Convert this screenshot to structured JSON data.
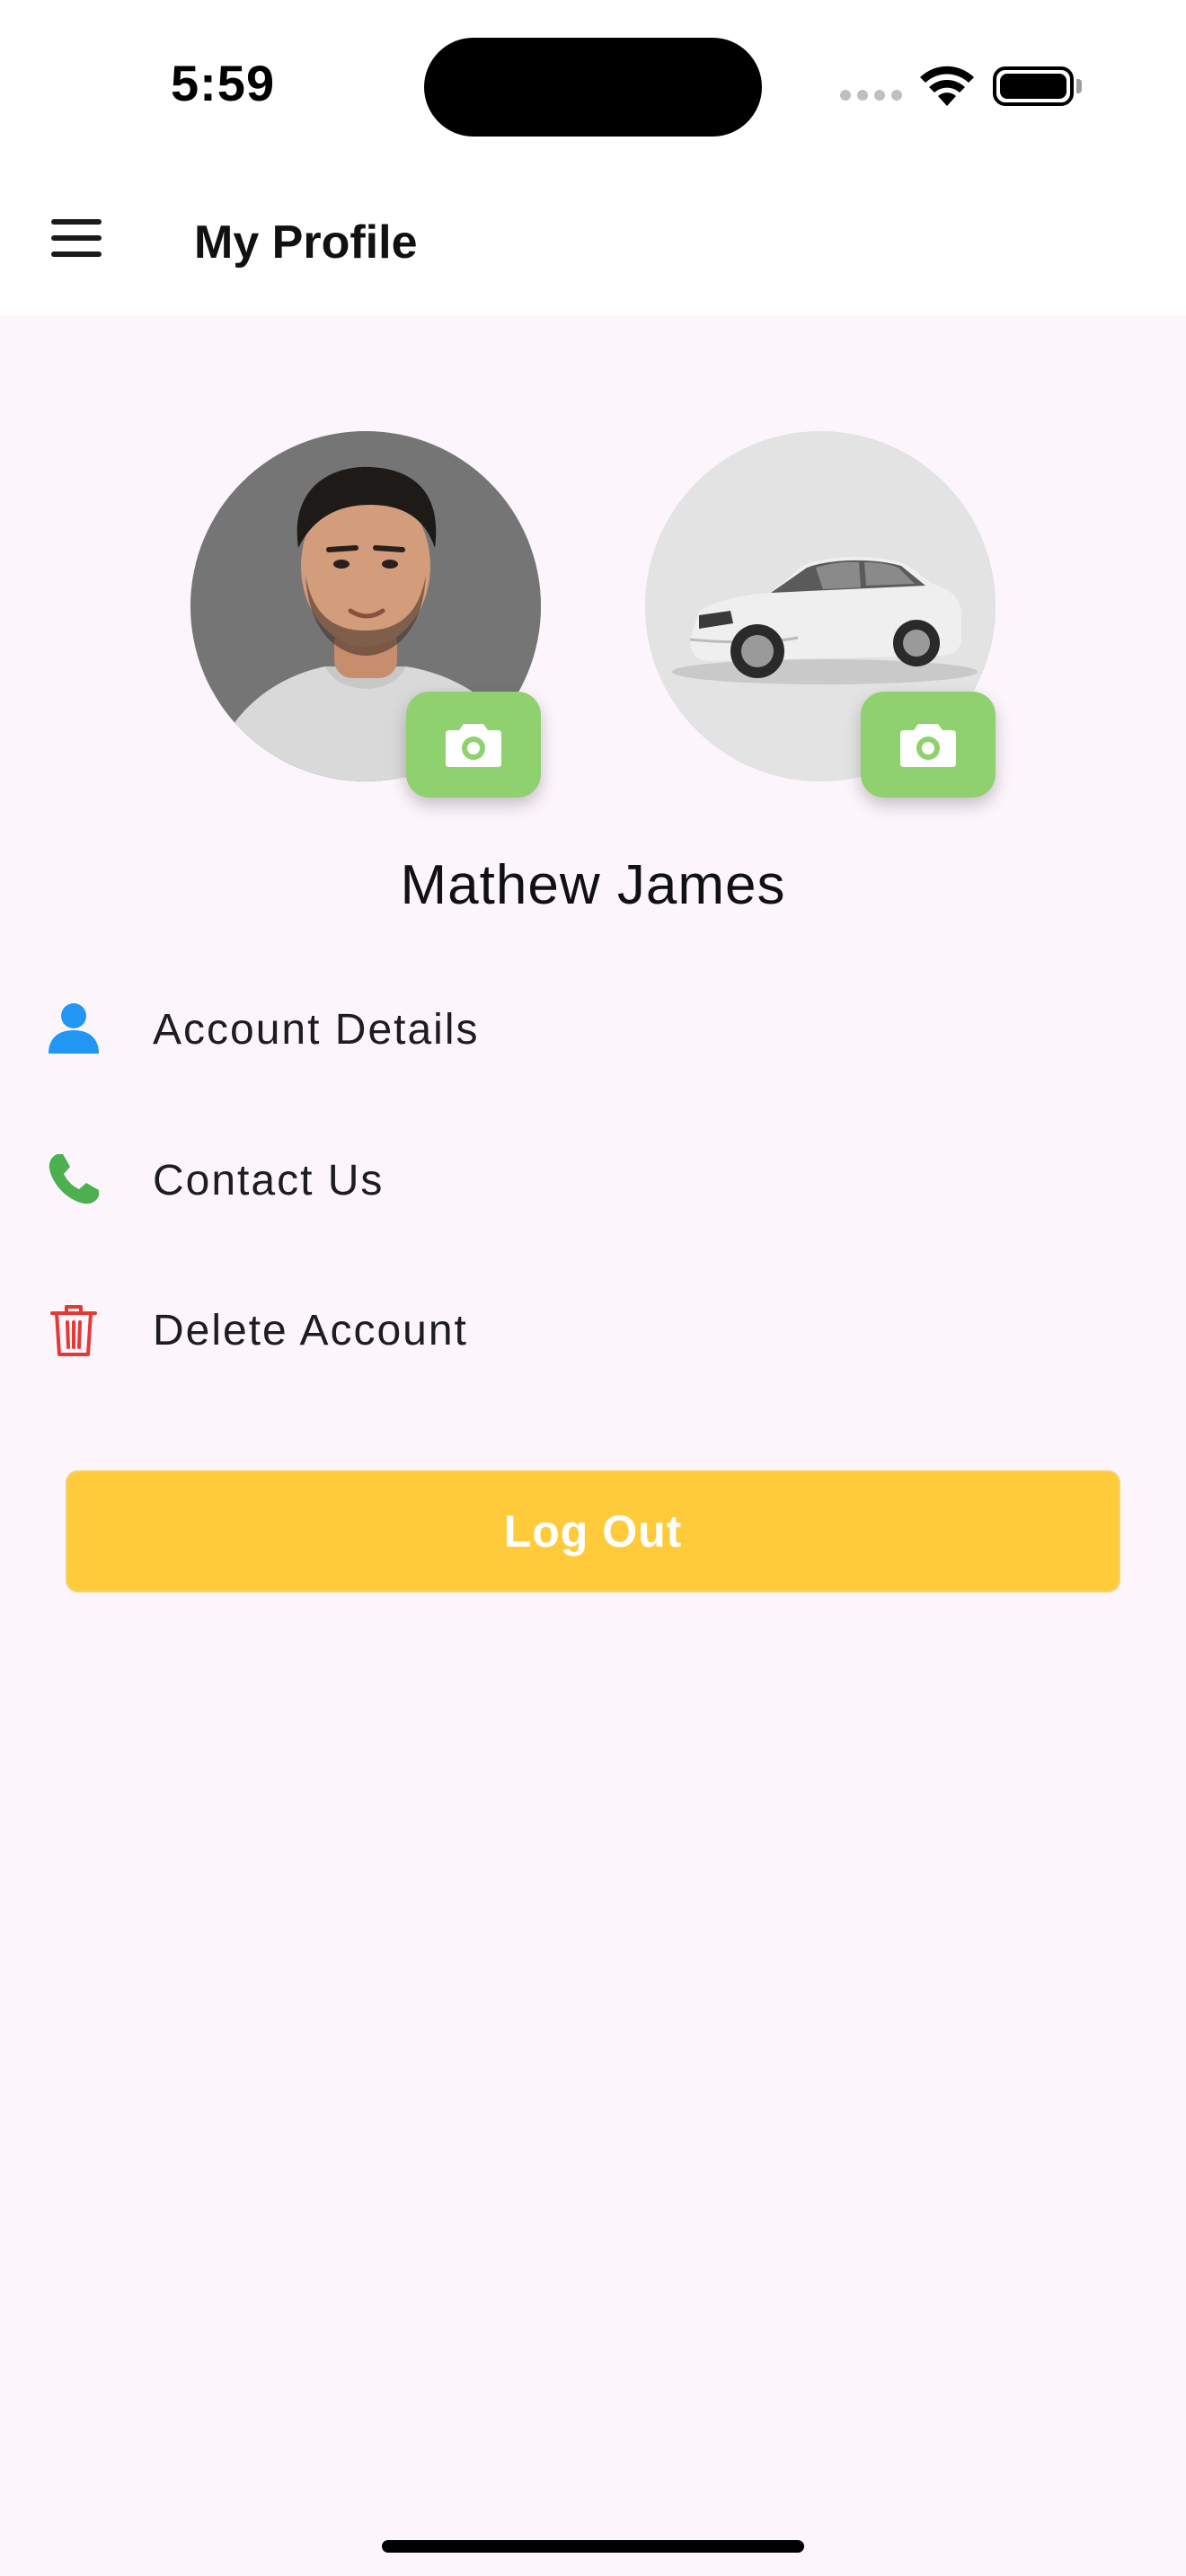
{
  "status_bar": {
    "time": "5:59"
  },
  "header": {
    "title": "My Profile",
    "menu_icon": "hamburger-menu-icon"
  },
  "profile": {
    "name": "Mathew James",
    "camera_icon": "camera-icon",
    "accent_color": "#8ED16E"
  },
  "menu": {
    "items": [
      {
        "label": "Account Details",
        "icon": "person-icon",
        "color": "#2196F3"
      },
      {
        "label": "Contact Us",
        "icon": "phone-icon",
        "color": "#4CAF50"
      },
      {
        "label": "Delete Account",
        "icon": "trash-icon",
        "color": "#E53935"
      }
    ]
  },
  "actions": {
    "logout_label": "Log Out",
    "logout_color": "#FFCB3A"
  }
}
